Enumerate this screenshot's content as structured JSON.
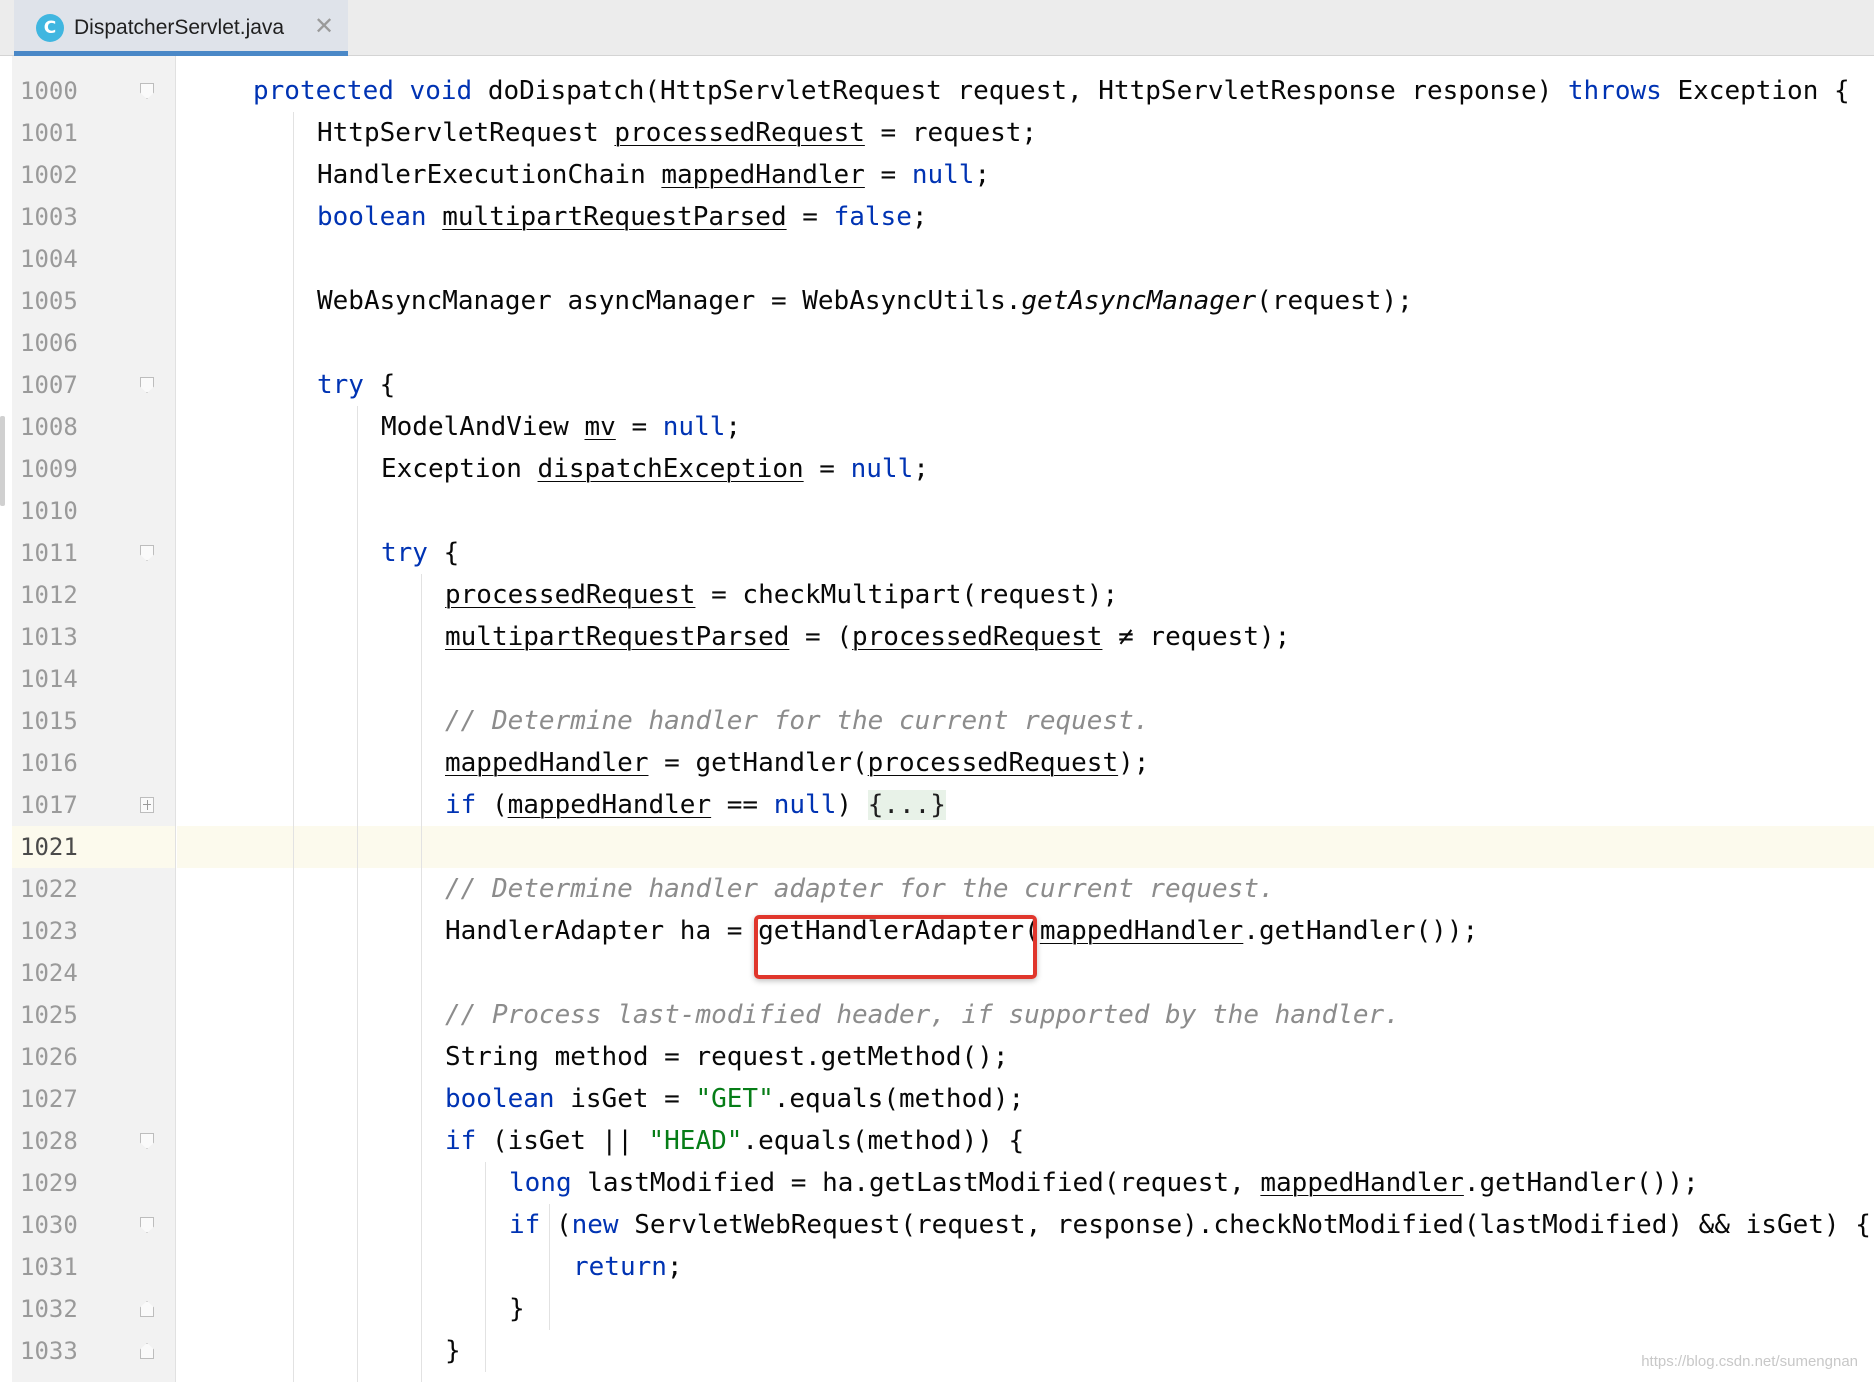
{
  "tab": {
    "icon_letter": "C",
    "title": "DispatcherServlet.java",
    "close_glyph": "✕"
  },
  "colors": {
    "keyword": "#0033b3",
    "comment": "#8c8c8c",
    "string": "#067d17",
    "highlight_box": "#e0362c",
    "current_line": "#fcfaed"
  },
  "editor": {
    "current_line_number": "1021",
    "highlighted_token": "getHandlerAdapter",
    "lines": [
      {
        "num": "1000",
        "fold": "start",
        "indent": 0,
        "tokens": [
          {
            "t": "protected",
            "c": "kw"
          },
          {
            "t": " "
          },
          {
            "t": "void",
            "c": "kw"
          },
          {
            "t": " doDispatch(HttpServletRequest request, HttpServletResponse response) "
          },
          {
            "t": "throws",
            "c": "kw"
          },
          {
            "t": " Exception {"
          }
        ]
      },
      {
        "num": "1001",
        "indent": 1,
        "tokens": [
          {
            "t": "HttpServletRequest "
          },
          {
            "t": "processedRequest",
            "c": "var"
          },
          {
            "t": " = request;"
          }
        ]
      },
      {
        "num": "1002",
        "indent": 1,
        "tokens": [
          {
            "t": "HandlerExecutionChain "
          },
          {
            "t": "mappedHandler",
            "c": "var"
          },
          {
            "t": " = "
          },
          {
            "t": "null",
            "c": "kw"
          },
          {
            "t": ";"
          }
        ]
      },
      {
        "num": "1003",
        "indent": 1,
        "tokens": [
          {
            "t": "boolean",
            "c": "kw"
          },
          {
            "t": " "
          },
          {
            "t": "multipartRequestParsed",
            "c": "var"
          },
          {
            "t": " = "
          },
          {
            "t": "false",
            "c": "kw"
          },
          {
            "t": ";"
          }
        ]
      },
      {
        "num": "1004",
        "indent": 0,
        "tokens": []
      },
      {
        "num": "1005",
        "indent": 1,
        "tokens": [
          {
            "t": "WebAsyncManager asyncManager = WebAsyncUtils."
          },
          {
            "t": "getAsyncManager",
            "c": "it"
          },
          {
            "t": "(request);"
          }
        ]
      },
      {
        "num": "1006",
        "indent": 0,
        "tokens": []
      },
      {
        "num": "1007",
        "fold": "start",
        "indent": 1,
        "tokens": [
          {
            "t": "try",
            "c": "kw"
          },
          {
            "t": " {"
          }
        ]
      },
      {
        "num": "1008",
        "indent": 2,
        "tokens": [
          {
            "t": "ModelAndView "
          },
          {
            "t": "mv",
            "c": "var"
          },
          {
            "t": " = "
          },
          {
            "t": "null",
            "c": "kw"
          },
          {
            "t": ";"
          }
        ]
      },
      {
        "num": "1009",
        "indent": 2,
        "tokens": [
          {
            "t": "Exception "
          },
          {
            "t": "dispatchException",
            "c": "var"
          },
          {
            "t": " = "
          },
          {
            "t": "null",
            "c": "kw"
          },
          {
            "t": ";"
          }
        ]
      },
      {
        "num": "1010",
        "indent": 0,
        "tokens": []
      },
      {
        "num": "1011",
        "fold": "start",
        "indent": 2,
        "tokens": [
          {
            "t": "try",
            "c": "kw"
          },
          {
            "t": " {"
          }
        ]
      },
      {
        "num": "1012",
        "indent": 3,
        "tokens": [
          {
            "t": "processedRequest",
            "c": "var"
          },
          {
            "t": " = checkMultipart(request);"
          }
        ]
      },
      {
        "num": "1013",
        "indent": 3,
        "tokens": [
          {
            "t": "multipartRequestParsed",
            "c": "var"
          },
          {
            "t": " = ("
          },
          {
            "t": "processedRequest",
            "c": "var"
          },
          {
            "t": " ≠ request);"
          }
        ]
      },
      {
        "num": "1014",
        "indent": 0,
        "tokens": []
      },
      {
        "num": "1015",
        "indent": 3,
        "tokens": [
          {
            "t": "// Determine handler for the current request.",
            "c": "cm"
          }
        ]
      },
      {
        "num": "1016",
        "indent": 3,
        "tokens": [
          {
            "t": "mappedHandler",
            "c": "var"
          },
          {
            "t": " = getHandler("
          },
          {
            "t": "processedRequest",
            "c": "var"
          },
          {
            "t": ");"
          }
        ]
      },
      {
        "num": "1017",
        "fold": "plus",
        "indent": 3,
        "tokens": [
          {
            "t": "if",
            "c": "kw"
          },
          {
            "t": " ("
          },
          {
            "t": "mappedHandler",
            "c": "var"
          },
          {
            "t": " == "
          },
          {
            "t": "null",
            "c": "kw"
          },
          {
            "t": ") "
          },
          {
            "t": "{...}",
            "c": "folded"
          }
        ]
      },
      {
        "num": "1021",
        "indent": 0,
        "tokens": []
      },
      {
        "num": "1022",
        "indent": 3,
        "tokens": [
          {
            "t": "// Determine handler adapter for the current request.",
            "c": "cm"
          }
        ]
      },
      {
        "num": "1023",
        "indent": 3,
        "tokens": [
          {
            "t": "HandlerAdapter ha = getHandlerAdapter("
          },
          {
            "t": "mappedHandler",
            "c": "var"
          },
          {
            "t": ".getHandler());"
          }
        ]
      },
      {
        "num": "1024",
        "indent": 0,
        "tokens": []
      },
      {
        "num": "1025",
        "indent": 3,
        "tokens": [
          {
            "t": "// Process last-modified header, if supported by the handler.",
            "c": "cm"
          }
        ]
      },
      {
        "num": "1026",
        "indent": 3,
        "tokens": [
          {
            "t": "String method = request.getMethod();"
          }
        ]
      },
      {
        "num": "1027",
        "indent": 3,
        "tokens": [
          {
            "t": "boolean",
            "c": "kw"
          },
          {
            "t": " isGet = "
          },
          {
            "t": "\"GET\"",
            "c": "st"
          },
          {
            "t": ".equals(method);"
          }
        ]
      },
      {
        "num": "1028",
        "fold": "start",
        "indent": 3,
        "tokens": [
          {
            "t": "if",
            "c": "kw"
          },
          {
            "t": " (isGet || "
          },
          {
            "t": "\"HEAD\"",
            "c": "st"
          },
          {
            "t": ".equals(method)) {"
          }
        ]
      },
      {
        "num": "1029",
        "indent": 4,
        "tokens": [
          {
            "t": "long",
            "c": "kw"
          },
          {
            "t": " lastModified = ha.getLastModified(request, "
          },
          {
            "t": "mappedHandler",
            "c": "var"
          },
          {
            "t": ".getHandler());"
          }
        ]
      },
      {
        "num": "1030",
        "fold": "start",
        "indent": 4,
        "tokens": [
          {
            "t": "if",
            "c": "kw"
          },
          {
            "t": " ("
          },
          {
            "t": "new",
            "c": "kw"
          },
          {
            "t": " ServletWebRequest(request, response).checkNotModified(lastModified) && isGet) {"
          }
        ]
      },
      {
        "num": "1031",
        "indent": 5,
        "tokens": [
          {
            "t": "return",
            "c": "kw"
          },
          {
            "t": ";"
          }
        ]
      },
      {
        "num": "1032",
        "fold": "end",
        "indent": 4,
        "tokens": [
          {
            "t": "}"
          }
        ]
      },
      {
        "num": "1033",
        "fold": "end",
        "indent": 3,
        "tokens": [
          {
            "t": "}"
          }
        ]
      }
    ]
  },
  "watermark": "https://blog.csdn.net/sumengnan"
}
